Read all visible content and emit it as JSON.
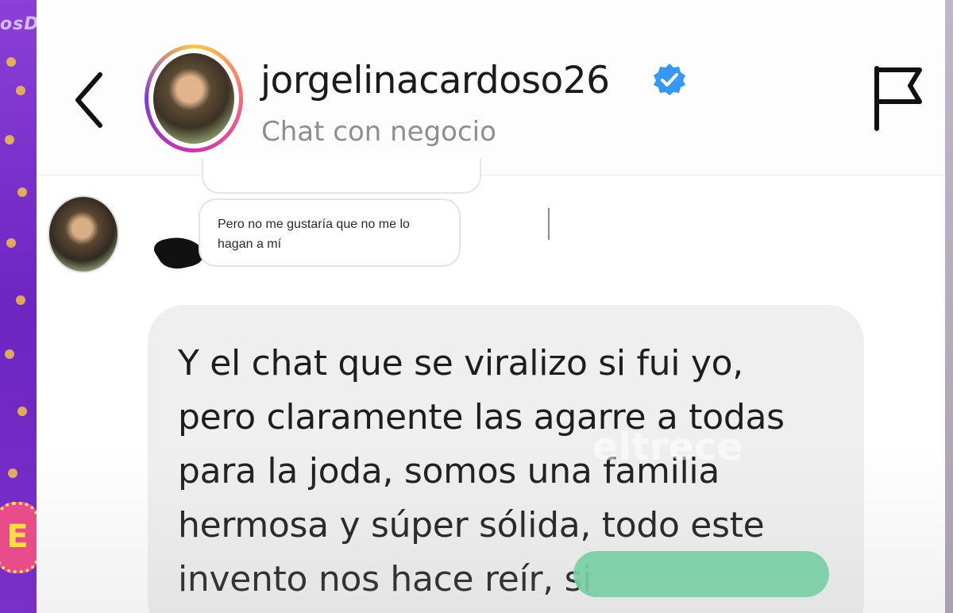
{
  "overlay": {
    "top_watermark": "osDelEspectáculo",
    "channel_logo": "E",
    "network_watermark": "eltrece"
  },
  "header": {
    "username": "jorgelinacardoso26",
    "subtitle": "Chat con negocio",
    "back_icon": "chevron-left-icon",
    "verified_icon": "verified-badge-icon",
    "flag_icon": "flag-icon",
    "verified_color": "#3897f0"
  },
  "chat": {
    "quoted_message": {
      "line1": "Pero no me gustaría que no me lo",
      "line2": "hagan a mí"
    },
    "message": {
      "lines": [
        "Y el chat que se viralizo si fui yo,",
        "pero claramente las agarre a todas",
        "para la joda, somos una familia",
        "hermosa y súper sólida, todo este",
        "invento nos hace reír, si"
      ],
      "bubble_color": "#efefef",
      "redaction_color": "#6fd3a0"
    }
  }
}
